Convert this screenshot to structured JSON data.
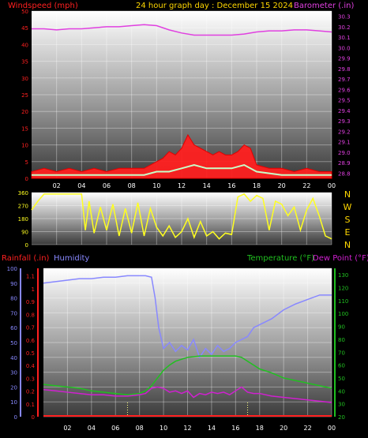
{
  "header": {
    "left_label": "Windspeed (mph)",
    "center_label": "24 hour graph day : December 15 2024",
    "right_label": "Barometer (.in)"
  },
  "colors": {
    "wind": "#ff2020",
    "gust": "#e00000",
    "wind_avg": "#c8ffc8",
    "barometer": "#e040e0",
    "direction": "#ffff20",
    "humidity": "#8888ff",
    "temperature": "#20c020",
    "dewpoint": "#d020d0",
    "rainfall": "#ff2020",
    "label_gold": "#ffd700",
    "grid": "#ffffff"
  },
  "chart_data": [
    {
      "type": "area",
      "name": "wind-barometer",
      "x_ticks": [
        "02",
        "04",
        "06",
        "08",
        "10",
        "12",
        "14",
        "16",
        "18",
        "20",
        "22",
        "00"
      ],
      "left_axis": {
        "label": "Windspeed (mph)",
        "ticks": [
          0,
          5,
          10,
          15,
          20,
          25,
          30,
          35,
          40,
          45,
          50
        ],
        "ylim": [
          0,
          50
        ]
      },
      "right_axis": {
        "label": "Barometer (.in)",
        "ticks": [
          28.8,
          28.9,
          29.0,
          29.1,
          29.2,
          29.3,
          29.4,
          29.5,
          29.6,
          29.7,
          29.8,
          29.9,
          30.0,
          30.1,
          30.2,
          30.3
        ],
        "ylim": [
          28.75,
          30.35
        ]
      },
      "series": [
        {
          "name": "Windspeed (mph)",
          "axis": "left",
          "x": [
            0,
            1,
            2,
            3,
            4,
            5,
            6,
            7,
            8,
            9,
            9.5,
            10,
            10.5,
            11,
            11.5,
            12,
            12.5,
            13,
            13.5,
            14,
            14.5,
            15,
            15.5,
            16,
            16.5,
            17,
            17.5,
            18,
            19,
            20,
            21,
            22,
            23,
            24
          ],
          "values": [
            2,
            3,
            2,
            3,
            2,
            3,
            2,
            3,
            3,
            3,
            4,
            5,
            6,
            8,
            7,
            9,
            13,
            10,
            9,
            8,
            7,
            8,
            7,
            7,
            8,
            10,
            9,
            4,
            3,
            3,
            2,
            3,
            2,
            2
          ]
        },
        {
          "name": "Average",
          "axis": "left",
          "x": [
            0,
            2,
            4,
            6,
            8,
            9,
            10,
            11,
            12,
            13,
            14,
            15,
            16,
            17,
            18,
            20,
            22,
            24
          ],
          "values": [
            1,
            1,
            1,
            1,
            1,
            1,
            2,
            2,
            3,
            4,
            3,
            3,
            3,
            4,
            2,
            1,
            1,
            1
          ]
        },
        {
          "name": "Barometer (.in)",
          "axis": "right",
          "x": [
            0,
            1,
            2,
            3,
            4,
            5,
            6,
            7,
            8,
            9,
            10,
            11,
            12,
            13,
            14,
            15,
            16,
            17,
            18,
            19,
            20,
            21,
            22,
            23,
            24
          ],
          "values": [
            30.18,
            30.18,
            30.17,
            30.18,
            30.18,
            30.19,
            30.2,
            30.2,
            30.21,
            30.22,
            30.21,
            30.17,
            30.14,
            30.12,
            30.12,
            30.12,
            30.12,
            30.13,
            30.15,
            30.16,
            30.16,
            30.17,
            30.17,
            30.16,
            30.15
          ]
        }
      ]
    },
    {
      "type": "line",
      "name": "wind-direction",
      "left_axis": {
        "ticks": [
          0,
          90,
          180,
          270,
          360
        ],
        "ylim": [
          0,
          360
        ]
      },
      "direction_labels": [
        "N",
        "W",
        "S",
        "E",
        "N"
      ],
      "series": [
        {
          "name": "Direction",
          "x": [
            0,
            0.5,
            1,
            1.5,
            2,
            3,
            4,
            4.3,
            4.6,
            5,
            5.5,
            6,
            6.5,
            7,
            7.5,
            8,
            8.5,
            9,
            9.5,
            10,
            10.5,
            11,
            11.5,
            12,
            12.5,
            13,
            13.5,
            14,
            14.5,
            15,
            15.5,
            16,
            16.5,
            17,
            17.5,
            18,
            18.5,
            19,
            19.5,
            20,
            20.5,
            21,
            21.5,
            22,
            22.5,
            23,
            23.5,
            24
          ],
          "values": [
            240,
            300,
            350,
            350,
            350,
            350,
            350,
            100,
            300,
            80,
            260,
            100,
            280,
            60,
            250,
            80,
            290,
            60,
            250,
            120,
            60,
            130,
            50,
            90,
            180,
            50,
            160,
            60,
            90,
            40,
            80,
            70,
            330,
            350,
            300,
            340,
            320,
            100,
            300,
            280,
            200,
            260,
            100,
            240,
            320,
            200,
            60,
            40
          ]
        }
      ]
    },
    {
      "type": "line",
      "name": "humidity-temperature",
      "left_axis": {
        "ticks": [
          0,
          10,
          20,
          30,
          40,
          50,
          60,
          70,
          80,
          90,
          100
        ],
        "ylim": [
          0,
          100
        ]
      },
      "rain_axis": {
        "ticks": [
          0,
          0.1,
          0.2,
          0.3,
          0.4,
          0.5,
          0.6,
          0.7,
          0.8,
          0.9,
          1,
          1.1
        ],
        "ylim": [
          0,
          1.16
        ]
      },
      "right_axis": {
        "ticks": [
          20,
          30,
          40,
          50,
          60,
          70,
          80,
          90,
          100,
          110,
          120,
          130
        ],
        "ylim": [
          20,
          135
        ]
      },
      "labels": {
        "rainfall": "Rainfall (.in)",
        "humidity": "Humidity",
        "temperature": "Temperature (°F)",
        "dewpoint": "Dew Point (°F)"
      },
      "series": [
        {
          "name": "Humidity",
          "axis": "left",
          "x": [
            0,
            1,
            2,
            3,
            4,
            5,
            6,
            7,
            8,
            8.5,
            9,
            9.3,
            9.6,
            10,
            10.5,
            11,
            11.5,
            12,
            12.5,
            13,
            13.5,
            14,
            14.5,
            15,
            15.5,
            16,
            16.5,
            17,
            17.5,
            18,
            19,
            20,
            21,
            22,
            23,
            24
          ],
          "values": [
            90,
            91,
            92,
            93,
            93,
            94,
            94,
            95,
            95,
            95,
            94,
            80,
            60,
            46,
            50,
            44,
            48,
            45,
            52,
            40,
            46,
            42,
            48,
            44,
            46,
            50,
            52,
            54,
            60,
            62,
            66,
            72,
            76,
            79,
            82,
            82
          ]
        },
        {
          "name": "Temperature (°F)",
          "axis": "right",
          "x": [
            0,
            1,
            2,
            3,
            4,
            5,
            6,
            7,
            8,
            8.5,
            9,
            9.5,
            10,
            10.5,
            11,
            12,
            13,
            14,
            15,
            16,
            16.5,
            17,
            17.5,
            18,
            19,
            20,
            21,
            22,
            23,
            24
          ],
          "values": [
            45,
            44,
            43,
            42,
            40,
            39,
            38,
            37,
            38,
            40,
            44,
            50,
            56,
            60,
            63,
            66,
            67,
            67,
            67,
            67,
            66,
            63,
            60,
            57,
            54,
            50,
            48,
            46,
            44,
            42
          ]
        },
        {
          "name": "Dew Point (°F)",
          "axis": "right",
          "x": [
            0,
            1,
            2,
            3,
            4,
            5,
            6,
            7,
            8,
            8.5,
            9,
            9.5,
            10,
            10.5,
            11,
            11.5,
            12,
            12.5,
            13,
            13.5,
            14,
            14.5,
            15,
            15.5,
            16,
            16.5,
            17,
            17.5,
            18,
            19,
            20,
            21,
            22,
            23,
            24
          ],
          "values": [
            41,
            40,
            39,
            38,
            37,
            37,
            36,
            36,
            37,
            38,
            42,
            43,
            42,
            39,
            40,
            38,
            40,
            35,
            38,
            37,
            39,
            38,
            39,
            37,
            40,
            43,
            39,
            38,
            38,
            36,
            35,
            34,
            33,
            32,
            31
          ]
        },
        {
          "name": "Rainfall (.in)",
          "axis": "rain",
          "x": [
            0,
            24
          ],
          "values": [
            0,
            0
          ]
        }
      ]
    }
  ]
}
